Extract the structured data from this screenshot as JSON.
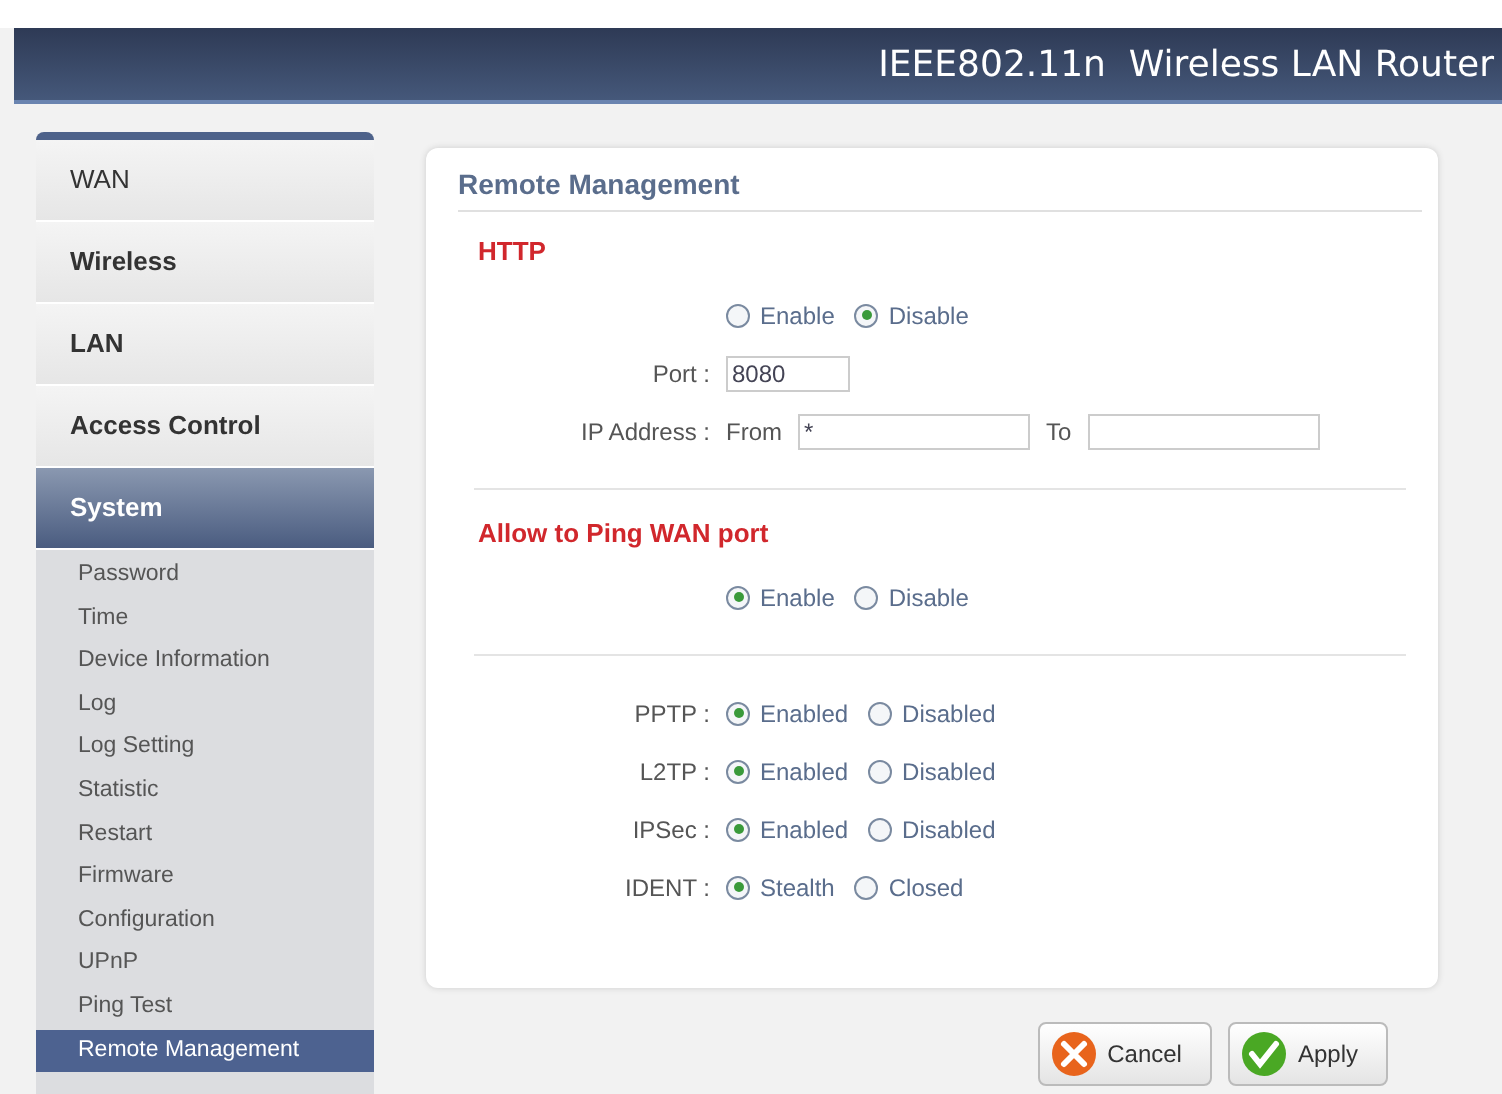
{
  "header": {
    "title": "IEEE802.11n  Wireless LAN Router"
  },
  "sidebar": {
    "items": [
      {
        "label": "WAN",
        "selected": false
      },
      {
        "label": "Wireless",
        "selected": false
      },
      {
        "label": "LAN",
        "selected": false
      },
      {
        "label": "Access Control",
        "selected": false
      },
      {
        "label": "System",
        "selected": true,
        "children": [
          {
            "label": "Password",
            "selected": false
          },
          {
            "label": "Time",
            "selected": false
          },
          {
            "label": "Device Information",
            "selected": false
          },
          {
            "label": "Log",
            "selected": false
          },
          {
            "label": "Log Setting",
            "selected": false
          },
          {
            "label": "Statistic",
            "selected": false
          },
          {
            "label": "Restart",
            "selected": false
          },
          {
            "label": "Firmware",
            "selected": false
          },
          {
            "label": "Configuration",
            "selected": false
          },
          {
            "label": "UPnP",
            "selected": false
          },
          {
            "label": "Ping Test",
            "selected": false
          },
          {
            "label": "Remote Management",
            "selected": true
          }
        ]
      }
    ]
  },
  "panel": {
    "title": "Remote Management",
    "sections": [
      {
        "heading": "HTTP",
        "rows": [
          {
            "kind": "radio",
            "options": [
              {
                "label": "Enable",
                "selected": false
              },
              {
                "label": "Disable",
                "selected": true
              }
            ]
          },
          {
            "kind": "field",
            "label": "Port :",
            "value": "8080"
          },
          {
            "kind": "range",
            "label": "IP Address :",
            "from_label": "From",
            "from_value": "*",
            "to_label": "To"
          }
        ]
      },
      {
        "heading": "Allow to Ping WAN port",
        "rows": [
          {
            "kind": "radio",
            "options": [
              {
                "label": "Enable",
                "selected": true
              },
              {
                "label": "Disable",
                "selected": false
              }
            ]
          }
        ]
      },
      {
        "rows": [
          {
            "kind": "radio",
            "label": "PPTP :",
            "options": [
              {
                "label": "Enabled",
                "selected": true
              },
              {
                "label": "Disabled",
                "selected": false
              }
            ]
          },
          {
            "kind": "radio",
            "label": "L2TP :",
            "options": [
              {
                "label": "Enabled",
                "selected": true
              },
              {
                "label": "Disabled",
                "selected": false
              }
            ]
          },
          {
            "kind": "radio",
            "label": "IPSec :",
            "options": [
              {
                "label": "Enabled",
                "selected": true
              },
              {
                "label": "Disabled",
                "selected": false
              }
            ]
          },
          {
            "kind": "radio",
            "label": "IDENT :",
            "options": [
              {
                "label": "Stealth",
                "selected": true
              },
              {
                "label": "Closed",
                "selected": false
              }
            ]
          }
        ]
      }
    ]
  },
  "buttons": [
    {
      "kind": "cancel",
      "label": "Cancel"
    },
    {
      "kind": "apply",
      "label": "Apply"
    }
  ]
}
